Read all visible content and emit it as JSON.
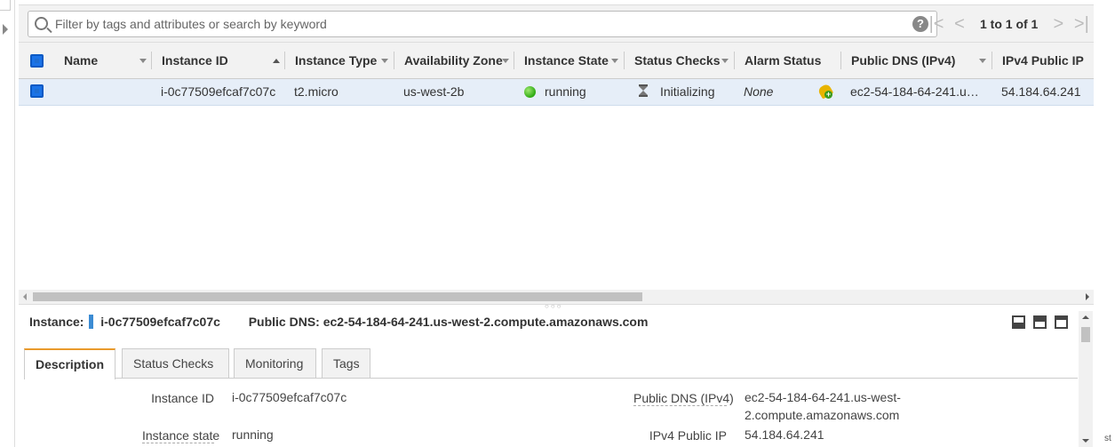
{
  "filter": {
    "placeholder": "Filter by tags and attributes or search by keyword",
    "help": "?"
  },
  "pager": {
    "first": "|<",
    "prev": "<",
    "range": "1 to 1 of 1",
    "next": ">",
    "last": ">|"
  },
  "columns": {
    "name": "Name",
    "instance_id": "Instance ID",
    "instance_type": "Instance Type",
    "availability_zone": "Availability Zone",
    "instance_state": "Instance State",
    "status_checks": "Status Checks",
    "alarm_status": "Alarm Status",
    "public_dns": "Public DNS (IPv4)",
    "ipv4_public_ip": "IPv4 Public IP"
  },
  "row": {
    "name": "",
    "instance_id": "i-0c77509efcaf7c07c",
    "instance_type": "t2.micro",
    "availability_zone": "us-west-2b",
    "instance_state": "running",
    "status_checks": "Initializing",
    "alarm_status": "None",
    "public_dns": "ec2-54-184-64-241.us-...",
    "ipv4_public_ip": "54.184.64.241"
  },
  "details": {
    "instance_label": "Instance:",
    "instance_value": "i-0c77509efcaf7c07c",
    "dns_label": "Public DNS:",
    "dns_value": "ec2-54-184-64-241.us-west-2.compute.amazonaws.com",
    "tabs": [
      "Description",
      "Status Checks",
      "Monitoring",
      "Tags"
    ],
    "fields": {
      "instance_id_label": "Instance ID",
      "instance_id_value": "i-0c77509efcaf7c07c",
      "instance_state_label": "Instance state",
      "instance_state_value": "running",
      "public_dns_label": "Public DNS (IPv4)",
      "public_dns_value_line1": "ec2-54-184-64-241.us-west-",
      "public_dns_value_line2": "2.compute.amazonaws.com",
      "ipv4_label": "IPv4 Public IP",
      "ipv4_value": "54.184.64.241"
    }
  },
  "edge_text": "st",
  "colors": {
    "accent_tab": "#e99a2c",
    "checkbox": "#1a73e8",
    "selected_row": "#e6eef8",
    "running": "#2eaa12"
  }
}
